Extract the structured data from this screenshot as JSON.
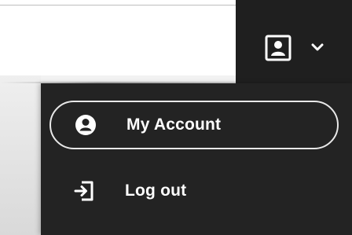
{
  "header": {
    "avatar_icon": "user-avatar-icon",
    "dropdown_icon": "chevron-down-icon",
    "colors": {
      "header_bg": "#1f1f1f",
      "menu_bg": "#232323",
      "text": "#ffffff",
      "outline": "#e8e8e8"
    }
  },
  "menu": {
    "items": [
      {
        "label": "My Account",
        "icon": "account-circle-icon",
        "active": true
      },
      {
        "label": "Log out",
        "icon": "logout-icon",
        "active": false
      }
    ]
  }
}
